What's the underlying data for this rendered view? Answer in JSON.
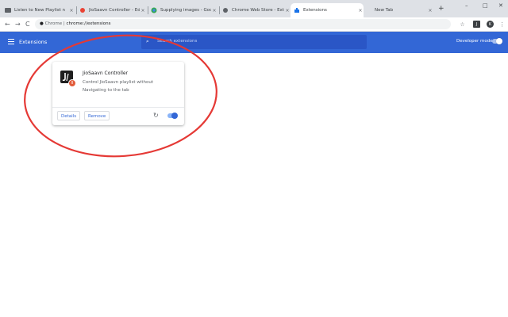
{
  "tabs": [
    {
      "title": "Listen to New Playlist n",
      "favicon": "playlist-icon",
      "active": false
    },
    {
      "title": "JioSaavn Controller - Edit It",
      "favicon": "mail-icon",
      "active": false
    },
    {
      "title": "Supplying images - Google",
      "favicon": "chrome-icon",
      "active": false
    },
    {
      "title": "Chrome Web Store - Extensi",
      "favicon": "store-icon",
      "active": false
    },
    {
      "title": "Extensions",
      "favicon": "puzzle-icon",
      "active": true
    },
    {
      "title": "New Tab",
      "favicon": "",
      "active": false
    }
  ],
  "tab_close_glyph": "×",
  "new_tab_glyph": "+",
  "window_controls": {
    "minimize": "–",
    "maximize": "□",
    "close": "✕"
  },
  "toolbar": {
    "back": "←",
    "forward": "→",
    "reload": "C",
    "url_site_label": "Chrome",
    "url_separator": "|",
    "url_path": "chrome://extensions",
    "star": "☆",
    "avatar_initial": "K",
    "menu": "⋮"
  },
  "header": {
    "title": "Extensions",
    "search_placeholder": "Search extensions",
    "developer_mode_label": "Developer mode",
    "developer_mode_on": false
  },
  "extension": {
    "name": "JioSaavn Controller",
    "description": "Control JioSaavn playlist without Navigating to the tab",
    "details_label": "Details",
    "remove_label": "Remove",
    "enabled": true,
    "badge_text": "II"
  },
  "colors": {
    "header": "#3367d6",
    "annotation_ellipse": "#e53935"
  }
}
